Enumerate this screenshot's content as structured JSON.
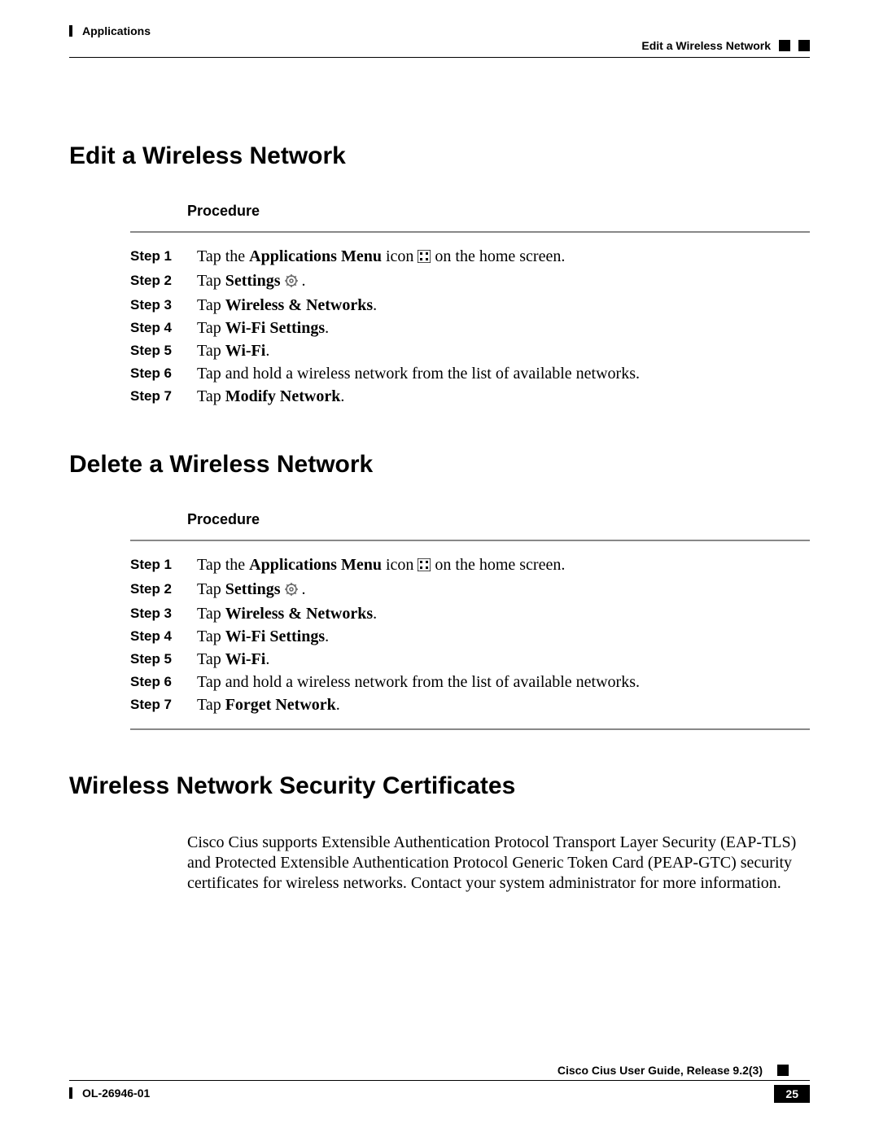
{
  "header": {
    "left": "Applications",
    "right": "Edit a Wireless Network"
  },
  "footer": {
    "doc_id": "OL-26946-01",
    "guide": "Cisco Cius User Guide, Release 9.2(3)",
    "page_num": "25"
  },
  "sections": {
    "edit": {
      "title": "Edit a Wireless Network",
      "proc_label": "Procedure",
      "steps": {
        "s1": {
          "label": "Step 1",
          "pre": "Tap the ",
          "bold": "Applications Menu",
          "mid": " icon ",
          "post": " on the home screen."
        },
        "s2": {
          "label": "Step 2",
          "pre": "Tap ",
          "bold": "Settings",
          "post": " ."
        },
        "s3": {
          "label": "Step 3",
          "pre": "Tap ",
          "bold": "Wireless & Networks",
          "post": "."
        },
        "s4": {
          "label": "Step 4",
          "pre": "Tap ",
          "bold": "Wi-Fi Settings",
          "post": "."
        },
        "s5": {
          "label": "Step 5",
          "pre": "Tap ",
          "bold": "Wi-Fi",
          "post": "."
        },
        "s6": {
          "label": "Step 6",
          "text": "Tap and hold a wireless network from the list of available networks."
        },
        "s7": {
          "label": "Step 7",
          "pre": "Tap ",
          "bold": "Modify Network",
          "post": "."
        }
      }
    },
    "delete": {
      "title": "Delete a Wireless Network",
      "proc_label": "Procedure",
      "steps": {
        "s1": {
          "label": "Step 1",
          "pre": "Tap the ",
          "bold": "Applications Menu",
          "mid": " icon ",
          "post": " on the home screen."
        },
        "s2": {
          "label": "Step 2",
          "pre": "Tap ",
          "bold": "Settings",
          "post": " ."
        },
        "s3": {
          "label": "Step 3",
          "pre": "Tap ",
          "bold": "Wireless & Networks",
          "post": "."
        },
        "s4": {
          "label": "Step 4",
          "pre": "Tap ",
          "bold": "Wi-Fi Settings",
          "post": "."
        },
        "s5": {
          "label": "Step 5",
          "pre": "Tap ",
          "bold": "Wi-Fi",
          "post": "."
        },
        "s6": {
          "label": "Step 6",
          "text": "Tap and hold a wireless network from the list of available networks."
        },
        "s7": {
          "label": "Step 7",
          "pre": "Tap ",
          "bold": "Forget Network",
          "post": "."
        }
      }
    },
    "certs": {
      "title": "Wireless Network Security Certificates",
      "body": "Cisco Cius supports Extensible Authentication Protocol Transport Layer Security (EAP-TLS) and Protected Extensible Authentication Protocol Generic Token Card (PEAP-GTC) security certificates for wireless networks. Contact your system administrator for more information."
    }
  }
}
